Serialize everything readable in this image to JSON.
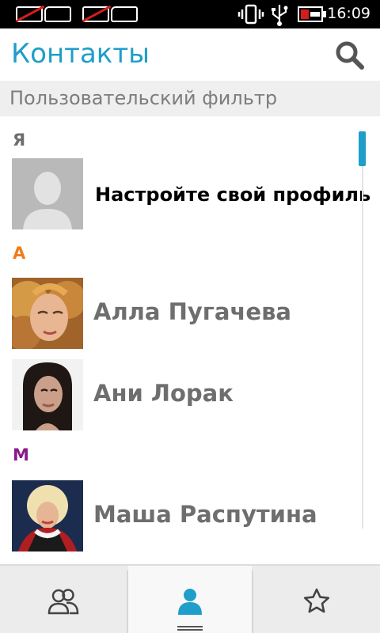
{
  "status_bar": {
    "time": "16:09",
    "icons": [
      "sim-1-no-signal-icon",
      "sim-2-no-signal-icon",
      "vibrate-icon",
      "usb-icon",
      "battery-charging-icon"
    ]
  },
  "header": {
    "title": "Контакты",
    "search_icon": "search-icon"
  },
  "filter": {
    "label": "Пользовательский фильтр"
  },
  "sections": [
    {
      "letter": "Я",
      "color": "#6e6e6e"
    },
    {
      "letter": "А",
      "color": "#f07c1a"
    },
    {
      "letter": "М",
      "color": "#8a1a8c"
    }
  ],
  "contacts": [
    {
      "name": "Настройте свой профиль",
      "avatar": "placeholder-avatar"
    },
    {
      "name": "Алла Пугачева",
      "avatar": "photo-avatar"
    },
    {
      "name": "Ани Лорак",
      "avatar": "photo-avatar"
    },
    {
      "name": "Маша Распутина",
      "avatar": "photo-avatar"
    }
  ],
  "bottom_nav": {
    "tabs": [
      {
        "icon": "groups-icon",
        "active": false
      },
      {
        "icon": "person-icon",
        "active": true
      },
      {
        "icon": "star-icon",
        "active": false
      }
    ]
  },
  "colors": {
    "accent": "#1e9ec9",
    "status_bar": "#000000",
    "filter_bg": "#efefef"
  }
}
